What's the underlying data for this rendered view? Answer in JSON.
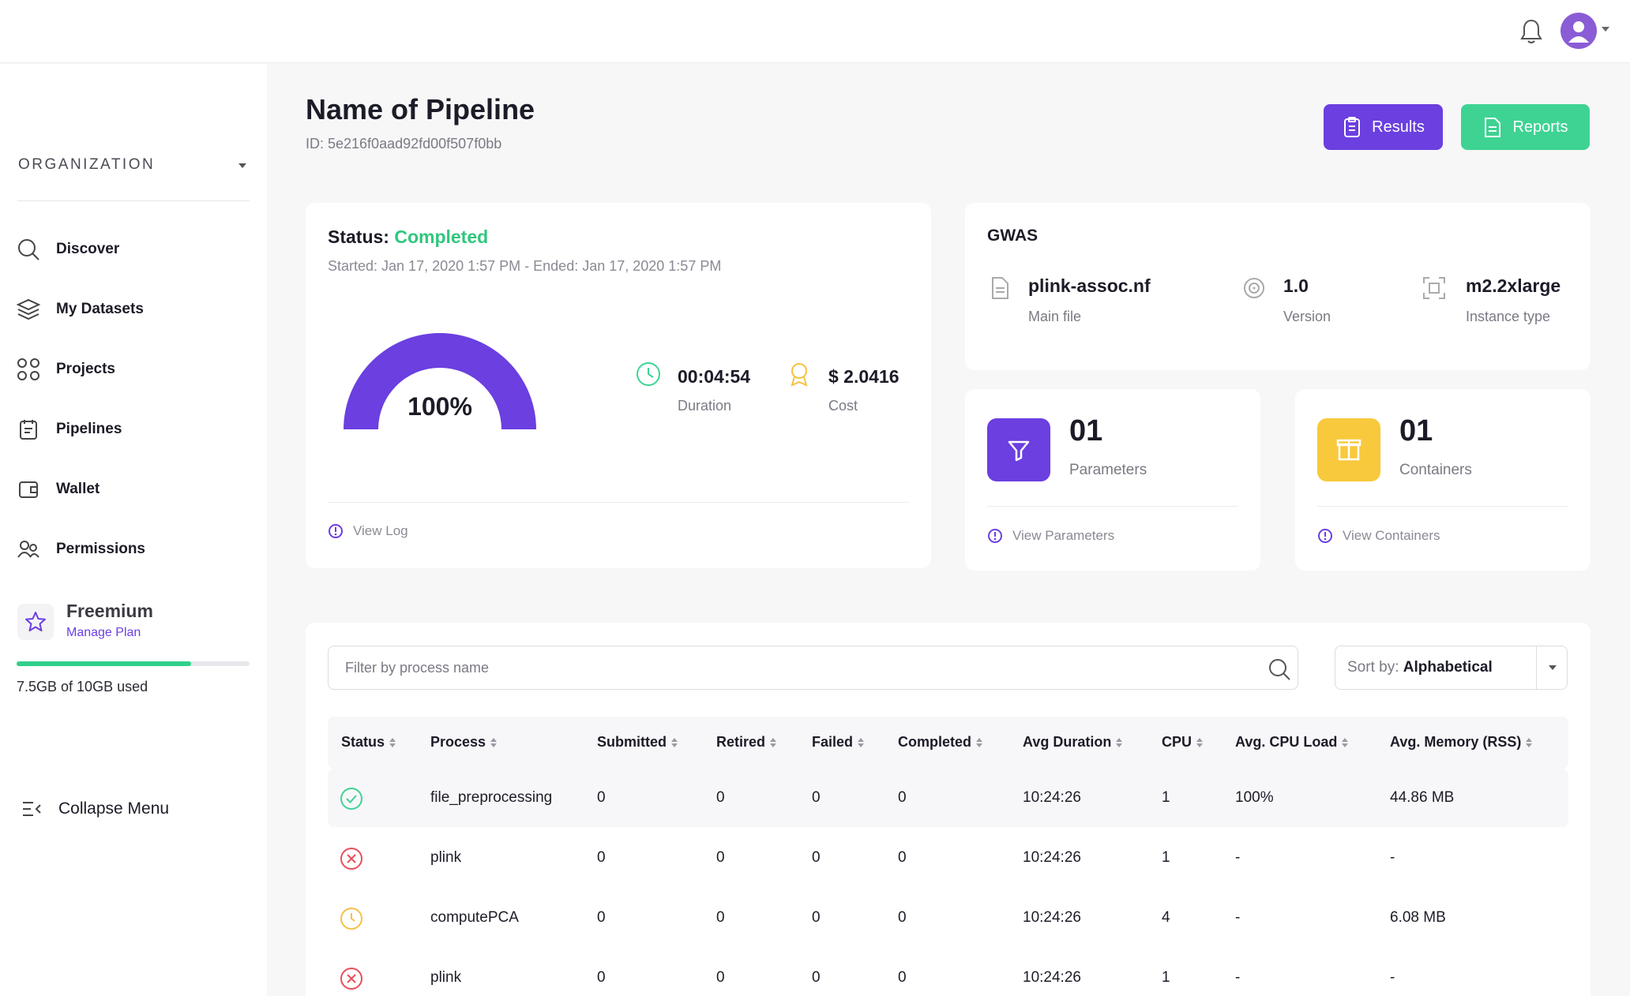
{
  "header": {
    "avatar_alt": "user"
  },
  "sidebar": {
    "org_label": "ORGANIZATION",
    "items": [
      {
        "label": "Discover",
        "icon": "search-icon"
      },
      {
        "label": "My Datasets",
        "icon": "layers-icon"
      },
      {
        "label": "Projects",
        "icon": "grid-icon"
      },
      {
        "label": "Pipelines",
        "icon": "clipboard-icon"
      },
      {
        "label": "Wallet",
        "icon": "wallet-icon"
      },
      {
        "label": "Permissions",
        "icon": "users-icon"
      }
    ],
    "plan": {
      "name": "Freemium",
      "link": "Manage Plan",
      "usage_fraction": 0.75,
      "usage_text": "7.5GB of 10GB used"
    },
    "collapse_label": "Collapse Menu"
  },
  "page": {
    "title": "Name of Pipeline",
    "id_text": "ID: 5e216f0aad92fd00f507f0bb",
    "results_label": "Results",
    "reports_label": "Reports"
  },
  "status_card": {
    "status_label": "Status:",
    "status_value": "Completed",
    "times": "Started: Jan 17, 2020 1:57 PM - Ended: Jan 17, 2020 1:57 PM",
    "progress_percent": 100,
    "progress_text": "100%",
    "duration_value": "00:04:54",
    "duration_label": "Duration",
    "cost_value": "$ 2.0416",
    "cost_label": "Cost",
    "view_log": "View Log"
  },
  "gwas_card": {
    "title": "GWAS",
    "main_file_value": "plink-assoc.nf",
    "main_file_label": "Main file",
    "version_value": "1.0",
    "version_label": "Version",
    "instance_value": "m2.2xlarge",
    "instance_label": "Instance type"
  },
  "parameters_card": {
    "count": "01",
    "label": "Parameters",
    "link": "View Parameters"
  },
  "containers_card": {
    "count": "01",
    "label": "Containers",
    "link": "View Containers"
  },
  "table": {
    "search_placeholder": "Filter by process name",
    "sort_prefix": "Sort by:",
    "sort_value": "Alphabetical",
    "columns": [
      "Status",
      "Process",
      "Submitted",
      "Retired",
      "Failed",
      "Completed",
      "Avg Duration",
      "CPU",
      "Avg. CPU Load",
      "Avg. Memory (RSS)"
    ],
    "rows": [
      {
        "status": "success",
        "process": "file_preprocessing",
        "submitted": "0",
        "retired": "0",
        "failed": "0",
        "completed": "0",
        "avg_duration": "10:24:26",
        "cpu": "1",
        "cpu_load": "100%",
        "memory": "44.86 MB"
      },
      {
        "status": "failed",
        "process": "plink",
        "submitted": "0",
        "retired": "0",
        "failed": "0",
        "completed": "0",
        "avg_duration": "10:24:26",
        "cpu": "1",
        "cpu_load": "-",
        "memory": "-"
      },
      {
        "status": "pending",
        "process": "computePCA",
        "submitted": "0",
        "retired": "0",
        "failed": "0",
        "completed": "0",
        "avg_duration": "10:24:26",
        "cpu": "4",
        "cpu_load": "-",
        "memory": "6.08 MB"
      },
      {
        "status": "failed",
        "process": "plink",
        "submitted": "0",
        "retired": "0",
        "failed": "0",
        "completed": "0",
        "avg_duration": "10:24:26",
        "cpu": "1",
        "cpu_load": "-",
        "memory": "-"
      }
    ]
  },
  "colors": {
    "accent": "#6b3fe0",
    "success": "#2fc77d",
    "danger": "#e8505b",
    "warning": "#f5c242",
    "containers_tile": "#f8c93c"
  }
}
